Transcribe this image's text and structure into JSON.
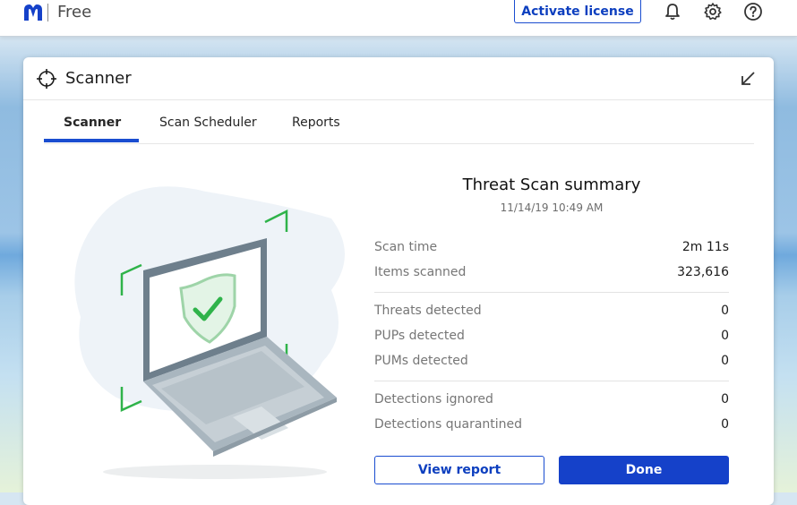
{
  "app": {
    "edition": "Free",
    "brand_color": "#1a4dd0"
  },
  "topbar": {
    "activate_label": "Activate license",
    "icons": [
      "bell-icon",
      "gear-icon",
      "help-icon"
    ]
  },
  "card": {
    "title": "Scanner",
    "icons": [
      "crosshair-icon",
      "collapse-arrow-icon"
    ]
  },
  "tabs": [
    {
      "label": "Scanner",
      "active": true
    },
    {
      "label": "Scan Scheduler",
      "active": false
    },
    {
      "label": "Reports",
      "active": false
    }
  ],
  "summary": {
    "title": "Threat Scan summary",
    "date": "11/14/19 10:49 AM",
    "scan_time_label": "Scan time",
    "scan_time": "2m 11s",
    "items_scanned_label": "Items scanned",
    "items_scanned": "323,616",
    "threats_label": "Threats detected",
    "threats": "0",
    "pups_label": "PUPs detected",
    "pups": "0",
    "pums_label": "PUMs detected",
    "pums": "0",
    "ignored_label": "Detections ignored",
    "ignored": "0",
    "quarantined_label": "Detections quarantined",
    "quarantined": "0"
  },
  "buttons": {
    "view_report": "View report",
    "done": "Done"
  },
  "illustration": {
    "icon": "laptop-shield-check-icon",
    "accent": "#2fb34a"
  }
}
